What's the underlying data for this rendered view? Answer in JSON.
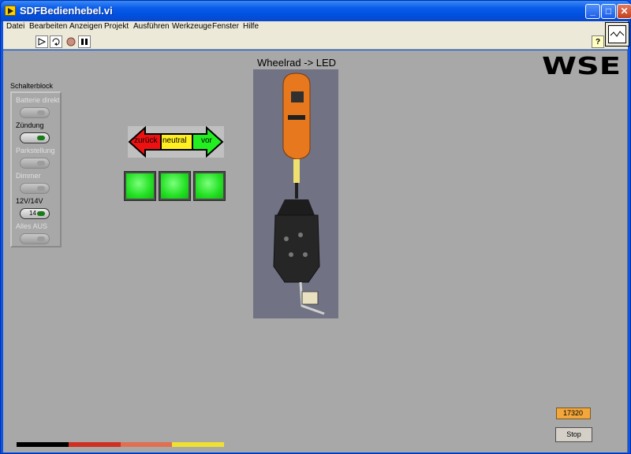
{
  "window": {
    "title": "SDFBedienhebel.vi"
  },
  "menu": [
    "Datei",
    "Bearbeiten",
    "Anzeigen",
    "Projekt",
    "Ausführen",
    "Werkzeuge",
    "Fenster",
    "Hilfe"
  ],
  "toolbar": {
    "help_label": "?"
  },
  "switch_block": {
    "label": "Schalterblock",
    "switches": [
      {
        "label": "Batterie direkt",
        "active": false,
        "text": ""
      },
      {
        "label": "Zündung",
        "active": true,
        "text": ""
      },
      {
        "label": "Parkstellung",
        "active": false,
        "text": ""
      },
      {
        "label": "Dimmer",
        "active": false,
        "text": ""
      },
      {
        "label": "12V/14V",
        "active": true,
        "text": "14"
      },
      {
        "label": "Alles AUS",
        "active": false,
        "text": ""
      }
    ]
  },
  "direction": {
    "left": "zurück",
    "center": "neutral",
    "right": "vor"
  },
  "led_count": 3,
  "photo": {
    "title": "Wheelrad -> LED"
  },
  "logo": {
    "text": "WSE"
  },
  "counter": {
    "value": "17320"
  },
  "stop_button": {
    "label": "Stop"
  },
  "colors": {
    "bar": [
      "#000000",
      "#d03020",
      "#e07050",
      "#f0e030"
    ]
  }
}
